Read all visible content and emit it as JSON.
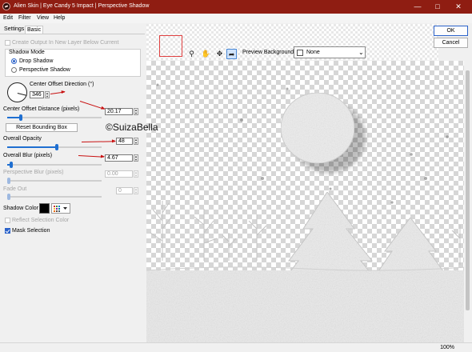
{
  "window": {
    "title": "Alien Skin | Eye Candy 5 Impact | Perspective Shadow",
    "title_bar_color": "#8f1d12",
    "controls": [
      "minimize-icon",
      "maximize-icon",
      "close-icon"
    ]
  },
  "menu": [
    "Edit",
    "Filter",
    "View",
    "Help"
  ],
  "tabs": [
    {
      "label": "Settings",
      "active": false
    },
    {
      "label": "Basic",
      "active": true
    }
  ],
  "basic": {
    "create_output_label": "Create Output In New Layer Below Current",
    "create_output_checked": false,
    "shadow_mode": {
      "legend": "Shadow Mode",
      "options": [
        {
          "label": "Drop Shadow",
          "selected": true
        },
        {
          "label": "Perspective Shadow",
          "selected": false
        }
      ]
    },
    "center_offset_direction": {
      "label": "Center Offset Direction (°)",
      "value": "346"
    },
    "center_offset_distance": {
      "label": "Center Offset Distance (pixels)",
      "value": "20.17",
      "slider_fraction": 0.14
    },
    "reset_button": "Reset Bounding Box",
    "overall_opacity": {
      "label": "Overall Opacity",
      "value": "48",
      "slider_fraction": 0.48
    },
    "overall_blur": {
      "label": "Overall Blur (pixels)",
      "value": "4.67",
      "slider_fraction": 0.06
    },
    "perspective_blur": {
      "label": "Perspective Blur (pixels)",
      "value": "0.00",
      "slider_fraction": 0.0
    },
    "fade_out": {
      "label": "Fade Out",
      "value": "0",
      "slider_fraction": 0.0
    },
    "shadow_color": {
      "label": "Shadow Color",
      "color": "#000000"
    },
    "reflect_selection_color": {
      "label": "Reflect Selection Color",
      "checked": false
    },
    "mask_selection": {
      "label": "Mask Selection",
      "checked": true
    }
  },
  "toolbar": {
    "tools": [
      "zoom-tool-icon",
      "hand-tool-icon",
      "pointer-tool-icon"
    ],
    "preview_background_label": "Preview Background:",
    "preview_background_value": "None"
  },
  "dialog": {
    "ok": "OK",
    "cancel": "Cancel"
  },
  "watermark": "©SuizaBella",
  "status": {
    "zoom": "100%"
  },
  "accent_color": "#1f6fd1",
  "annotation_color": "#c81010"
}
